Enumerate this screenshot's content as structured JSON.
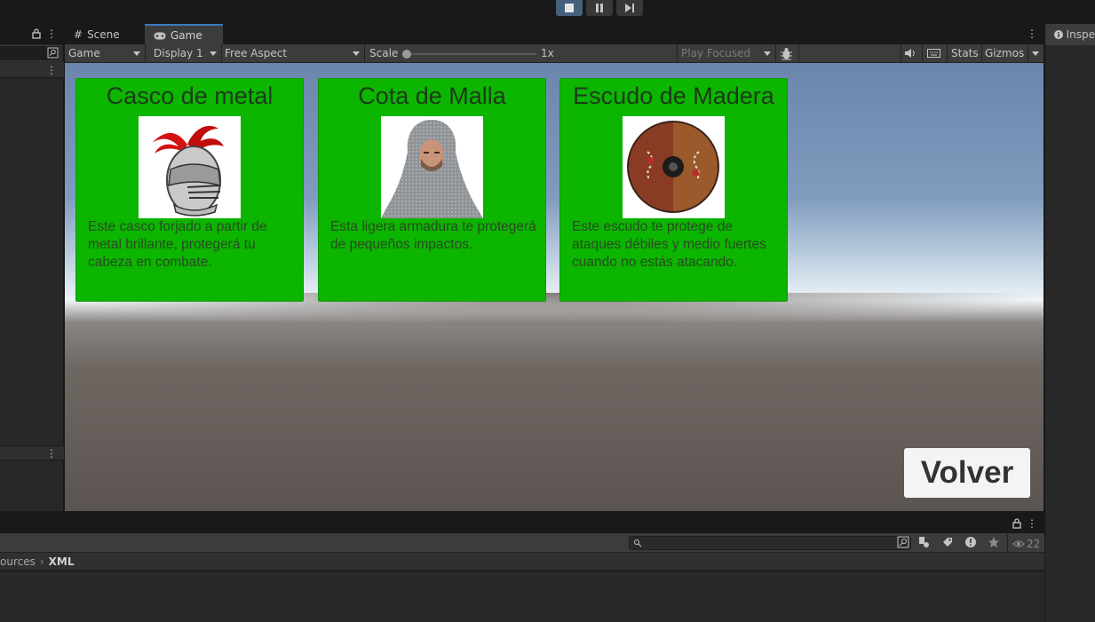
{
  "tabs": {
    "scene": "Scene",
    "game": "Game"
  },
  "toolbar": {
    "mode": "Game",
    "display": "Display 1",
    "aspect": "Free Aspect",
    "scale_label": "Scale",
    "scale_value": "1x",
    "play_focused": "Play Focused",
    "stats": "Stats",
    "gizmos": "Gizmos"
  },
  "items": [
    {
      "title": "Casco de metal",
      "description": "Este casco forjado a partir de metal brillante, protegerá tu cabeza en combate.",
      "icon": "knight-helmet"
    },
    {
      "title": "Cota de Malla",
      "description": "Esta ligera armadura te protegerá de pequeños impactos.",
      "icon": "chainmail-coif"
    },
    {
      "title": "Escudo de Madera",
      "description": "Este escudo te protege de ataques débiles y medio fuertes cuando no estás atacando.",
      "icon": "wooden-shield"
    }
  ],
  "volver_label": "Volver",
  "inspector": {
    "tab_label": "Inspe"
  },
  "project": {
    "breadcrumb": [
      "ources",
      "XML"
    ],
    "visible_count": "22"
  },
  "colors": {
    "card_green": "#0bb500",
    "accent_blue": "#3a79bb"
  }
}
